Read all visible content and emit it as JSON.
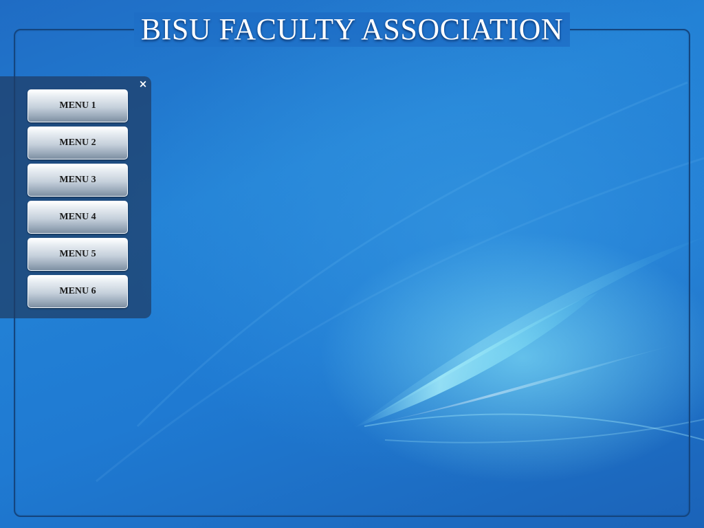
{
  "header": {
    "title": "BISU FACULTY ASSOCIATION"
  },
  "menu": {
    "close_glyph": "×",
    "items": [
      {
        "label": "MENU 1"
      },
      {
        "label": "MENU 2"
      },
      {
        "label": "MENU 3"
      },
      {
        "label": "MENU 4"
      },
      {
        "label": "MENU 5"
      },
      {
        "label": "MENU 6"
      }
    ]
  },
  "icons": {
    "close": "close-icon"
  },
  "colors": {
    "background": "#1f72c9",
    "frame_border": "#14457f",
    "panel": "#1e3c64",
    "button_text": "#1a1a1a",
    "title_text": "#ffffff"
  }
}
